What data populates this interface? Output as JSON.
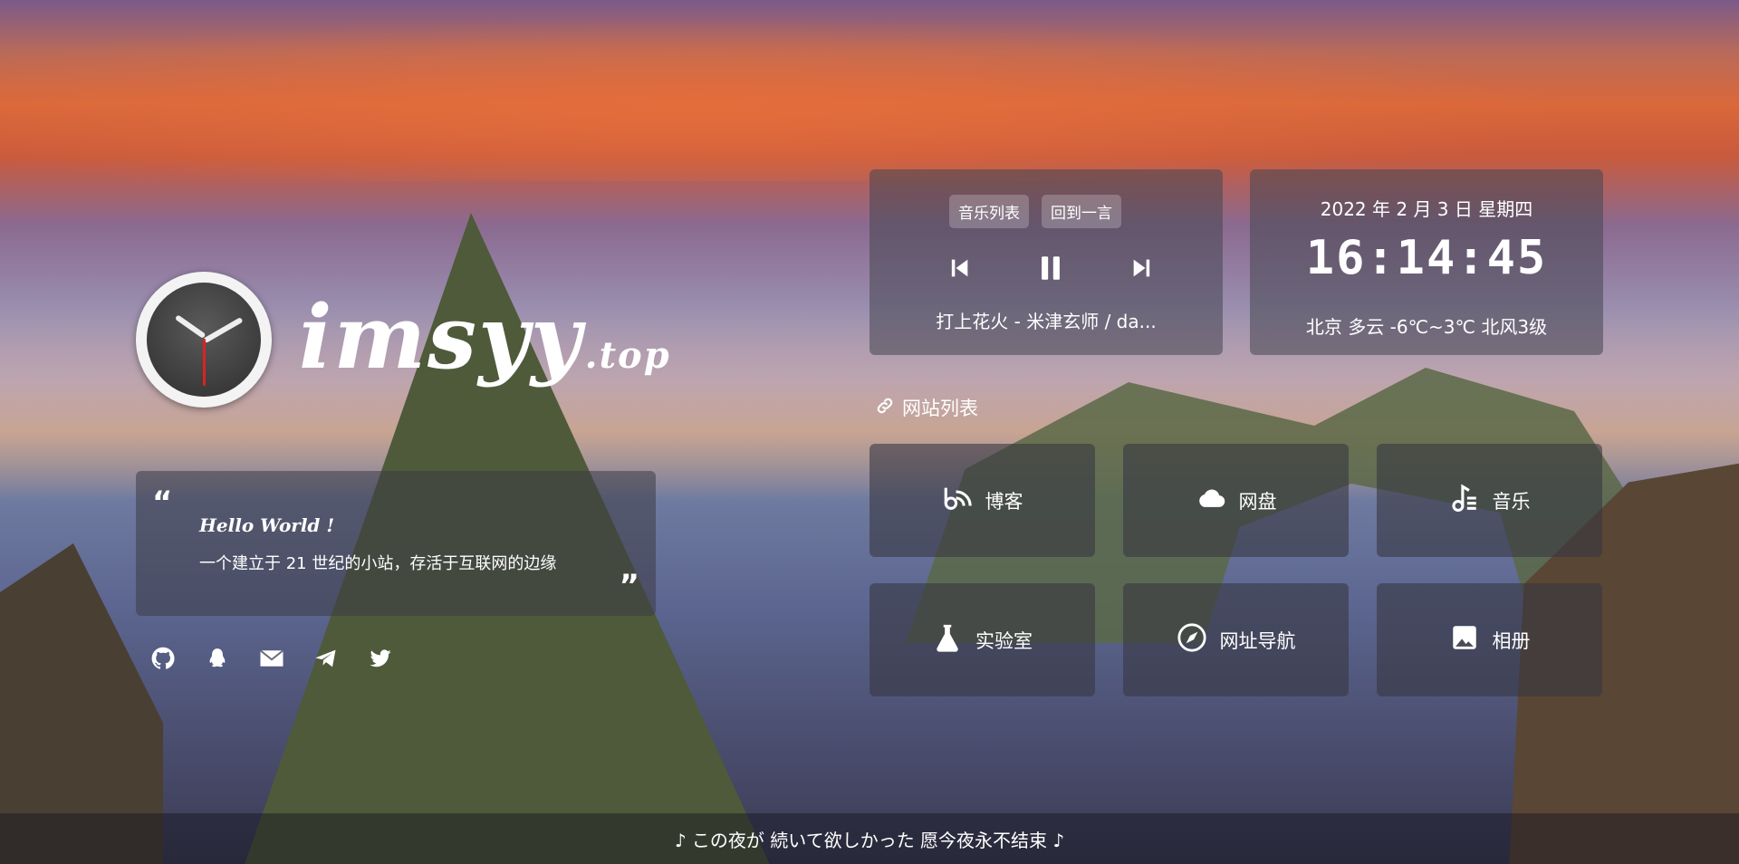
{
  "brand": {
    "name": "imsyy",
    "suffix": ".top"
  },
  "quote": {
    "title": "Hello World !",
    "text": "一个建立于 21 世纪的小站，存活于互联网的边缘",
    "open_mark": "“",
    "close_mark": "”"
  },
  "social": [
    "github-icon",
    "qq-icon",
    "mail-icon",
    "telegram-icon",
    "twitter-icon"
  ],
  "music": {
    "playlist_label": "音乐列表",
    "back_label": "回到一言",
    "now_playing": "打上花火 - 米津玄师 / da..."
  },
  "clock": {
    "date": "2022 年 2 月 3 日 星期四",
    "time": "16:14:45",
    "weather": "北京 多云 -6℃~3℃ 北风3级"
  },
  "sites_heading": "网站列表",
  "sites": [
    {
      "label": "博客",
      "icon": "blog-icon"
    },
    {
      "label": "网盘",
      "icon": "cloud-icon"
    },
    {
      "label": "音乐",
      "icon": "music-note-icon"
    },
    {
      "label": "实验室",
      "icon": "flask-icon"
    },
    {
      "label": "网址导航",
      "icon": "compass-icon"
    },
    {
      "label": "相册",
      "icon": "image-icon"
    }
  ],
  "footer": {
    "lyric": "♪ この夜が 続いて欲しかった 愿今夜永不结束 ♪"
  }
}
